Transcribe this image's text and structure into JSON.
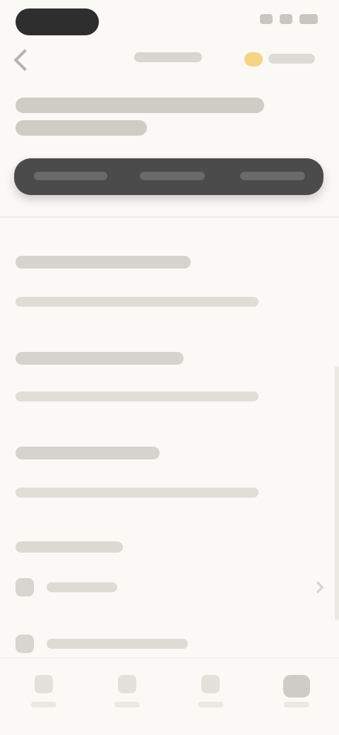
{
  "screen": {
    "state": "blurred",
    "background_color": "#fbf9f5",
    "accent_dark": "#4b4b4b",
    "coin_color": "#f4d487"
  },
  "status_bar": {
    "icons": [
      "signal-icon",
      "wifi-icon",
      "battery-icon"
    ]
  },
  "top_nav": {
    "icons": [
      "back-icon",
      "coin-icon"
    ]
  },
  "segments": {
    "count": 3
  },
  "entries": {
    "count": 3
  },
  "settings_rows": {
    "count": 2,
    "icons": [
      "settings-row-icon",
      "settings-row-icon"
    ]
  },
  "bottom_nav": {
    "tabs": 4,
    "active_tab_index": 3
  }
}
